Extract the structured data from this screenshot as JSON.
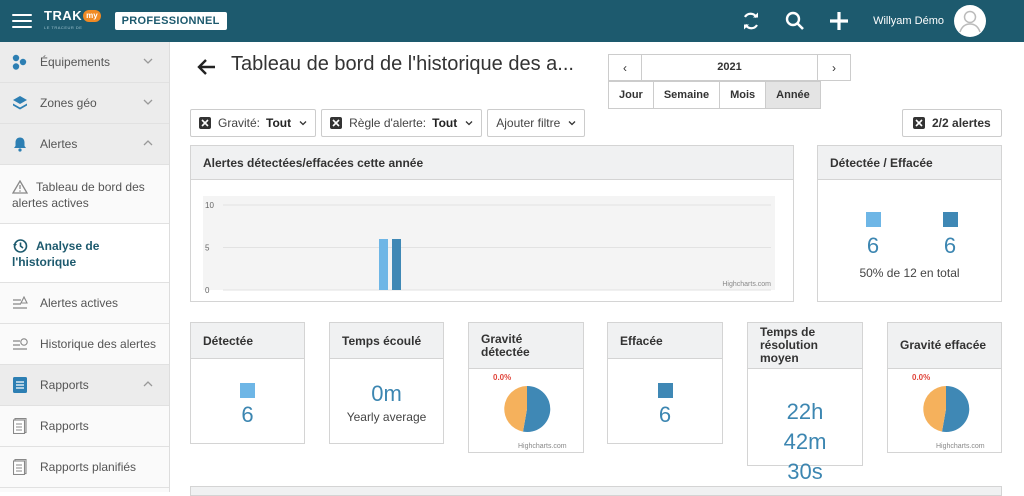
{
  "topbar": {
    "logo_text": "TRAK",
    "logo_badge": "my",
    "logo_sub": "LE TRACEUR DE",
    "edition": "PROFESSIONNEL",
    "user_name": "Willyam Démo"
  },
  "sidebar": {
    "items": [
      {
        "label": "Équipements",
        "icon": "equipment-icon"
      },
      {
        "label": "Zones géo",
        "icon": "layers-icon"
      },
      {
        "label": "Alertes",
        "icon": "bell-icon"
      },
      {
        "label": "Tableau de bord des alertes actives",
        "icon": "warning-icon"
      },
      {
        "label": "Analyse de l'historique",
        "icon": "history-icon"
      },
      {
        "label": "Alertes actives",
        "icon": "active-alerts-icon"
      },
      {
        "label": "Historique des alertes",
        "icon": "alert-history-icon"
      },
      {
        "label": "Rapports",
        "icon": "report-icon"
      },
      {
        "label": "Rapports",
        "icon": "document-icon"
      },
      {
        "label": "Rapports planifiés",
        "icon": "scheduled-document-icon"
      }
    ]
  },
  "header": {
    "title": "Tableau de bord de l'historique des a...",
    "year": "2021",
    "periods": [
      "Jour",
      "Semaine",
      "Mois",
      "Année"
    ],
    "selected_period": "Année"
  },
  "filters": {
    "gravity_label": "Gravité:",
    "gravity_value": "Tout",
    "rule_label": "Règle d'alerte:",
    "rule_value": "Tout",
    "add_filter": "Ajouter filtre",
    "alerts_count": "2/2 alertes"
  },
  "cards": {
    "chart_title": "Alertes détectées/effacées cette année",
    "detected_cleared_title": "Détectée / Effacée",
    "detected_value": "6",
    "cleared_value": "6",
    "total_text": "50% de 12 en total",
    "detected_title": "Détectée",
    "detected_count": "6",
    "elapsed_title": "Temps écoulé",
    "elapsed_value": "0m",
    "elapsed_sub": "Yearly average",
    "gravity_detected_title": "Gravité détectée",
    "gravity_detected_pct": "0.0%",
    "cleared_title": "Effacée",
    "cleared_count": "6",
    "resolution_title": "Temps de résolution moyen",
    "resolution_h": "22h",
    "resolution_m": "42m",
    "resolution_s": "30s",
    "gravity_cleared_title": "Gravité effacée",
    "gravity_cleared_pct": "0.0%",
    "credit": "Highcharts.com"
  },
  "colors": {
    "detected": "#6eb6e6",
    "cleared": "#3f88b5",
    "pie_orange": "#f5b15c",
    "pie_blue": "#3f88b5",
    "topbar": "#1d5a6e"
  },
  "chart_data": {
    "type": "bar",
    "title": "Alertes détectées/effacées cette année",
    "y_ticks": [
      "10",
      "5",
      "0"
    ],
    "ylim": [
      0,
      10
    ],
    "series": [
      {
        "values": [
          6
        ]
      },
      {
        "values": [
          6
        ]
      }
    ]
  }
}
